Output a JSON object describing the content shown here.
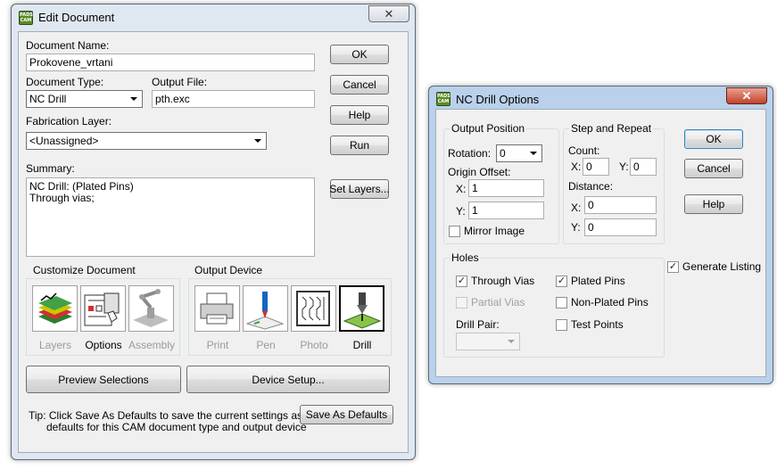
{
  "edit_document": {
    "title": "Edit Document",
    "close_glyph": "✕",
    "app_icon_text": "PADS CAM",
    "document_name_label": "Document Name:",
    "document_name_value": "Prokovene_vrtani",
    "document_type_label": "Document Type:",
    "document_type_value": "NC Drill",
    "output_file_label": "Output File:",
    "output_file_value": "pth.exc",
    "fabrication_layer_label": "Fabrication Layer:",
    "fabrication_layer_value": "<Unassigned>",
    "summary_label": "Summary:",
    "summary_lines": [
      "NC Drill: (Plated Pins)",
      "Through vias;"
    ],
    "buttons": {
      "ok": "OK",
      "cancel": "Cancel",
      "help": "Help",
      "run": "Run",
      "set_layers": "Set Layers...",
      "preview_selections": "Preview Selections",
      "device_setup": "Device Setup...",
      "save_as_defaults": "Save As Defaults"
    },
    "customize_document": {
      "title": "Customize Document",
      "items": [
        {
          "label": "Layers",
          "enabled": false,
          "icon": "layers-icon"
        },
        {
          "label": "Options",
          "enabled": true,
          "icon": "options-icon"
        },
        {
          "label": "Assembly",
          "enabled": false,
          "icon": "assembly-icon"
        }
      ]
    },
    "output_device": {
      "title": "Output Device",
      "items": [
        {
          "label": "Print",
          "enabled": false,
          "icon": "printer-icon"
        },
        {
          "label": "Pen",
          "enabled": false,
          "icon": "pen-plotter-icon"
        },
        {
          "label": "Photo",
          "enabled": false,
          "icon": "photo-plotter-icon"
        },
        {
          "label": "Drill",
          "enabled": true,
          "selected": true,
          "icon": "drill-icon"
        }
      ]
    },
    "tip_line1": "Tip: Click Save As Defaults to save the current settings as the",
    "tip_line2": "defaults for this CAM document type and output device"
  },
  "nc_drill_options": {
    "title": "NC Drill Options",
    "close_glyph": "✕",
    "app_icon_text": "PADS CAM",
    "output_position": {
      "title": "Output Position",
      "rotation_label": "Rotation:",
      "rotation_value": "0",
      "origin_offset_label": "Origin Offset:",
      "x_label": "X:",
      "x_value": "1",
      "y_label": "Y:",
      "y_value": "1",
      "mirror_image_label": "Mirror Image",
      "mirror_image_checked": false
    },
    "step_and_repeat": {
      "title": "Step and Repeat",
      "count_label": "Count:",
      "count_x_label": "X:",
      "count_x_value": "0",
      "count_y_label": "Y:",
      "count_y_value": "0",
      "distance_label": "Distance:",
      "distance_x_label": "X:",
      "distance_x_value": "0",
      "distance_y_label": "Y:",
      "distance_y_value": "0"
    },
    "buttons": {
      "ok": "OK",
      "cancel": "Cancel",
      "help": "Help"
    },
    "generate_listing_label": "Generate Listing",
    "generate_listing_checked": true,
    "holes": {
      "title": "Holes",
      "through_vias_label": "Through Vias",
      "through_vias_checked": true,
      "partial_vias_label": "Partial Vias",
      "partial_vias_checked": false,
      "plated_pins_label": "Plated Pins",
      "plated_pins_checked": true,
      "non_plated_pins_label": "Non-Plated Pins",
      "non_plated_pins_checked": false,
      "test_points_label": "Test Points",
      "test_points_checked": false,
      "drill_pair_label": "Drill Pair:",
      "drill_pair_value": ""
    }
  }
}
